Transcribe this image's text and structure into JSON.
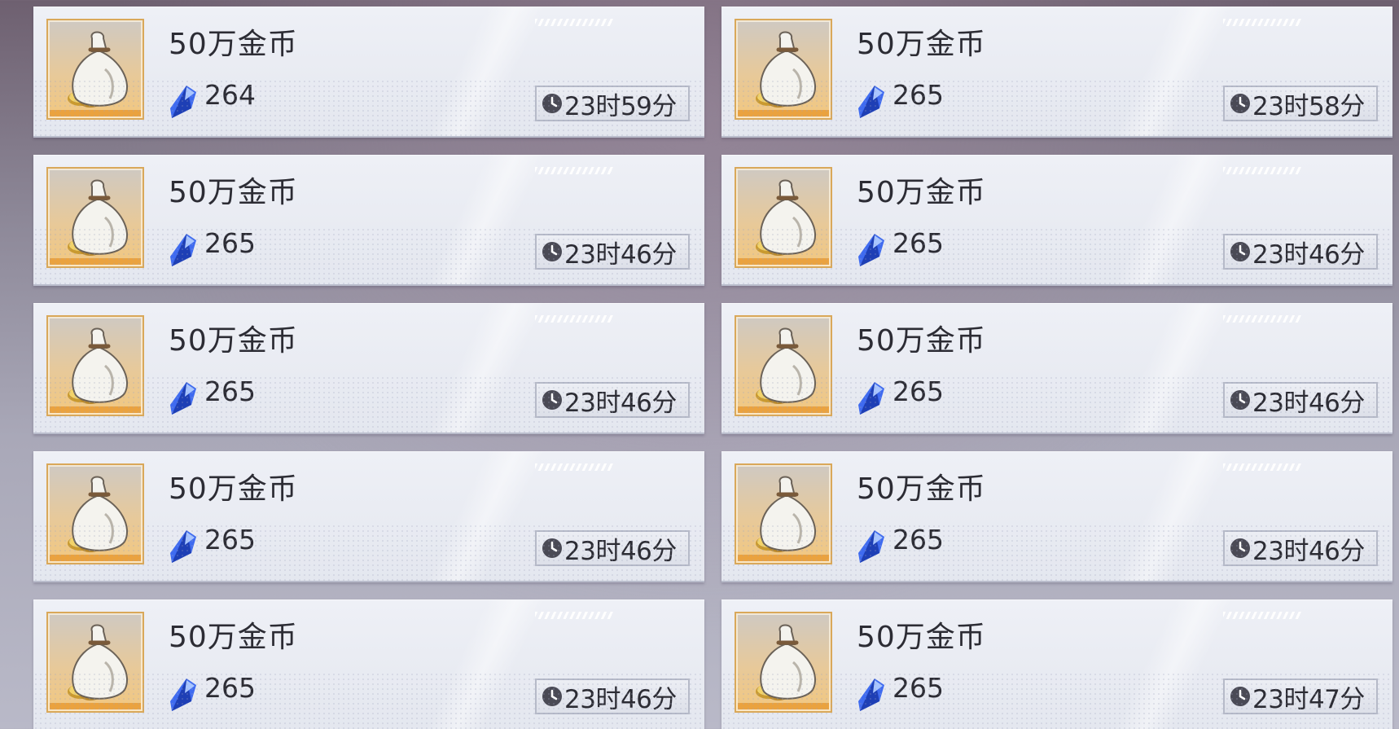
{
  "shop": {
    "items": [
      {
        "name": "50万金币",
        "price": "264",
        "timer": "23时59分",
        "item_icon": "coin-bag-icon",
        "currency_icon": "blue-crystal-icon",
        "timer_icon": "clock-icon"
      },
      {
        "name": "50万金币",
        "price": "265",
        "timer": "23时58分",
        "item_icon": "coin-bag-icon",
        "currency_icon": "blue-crystal-icon",
        "timer_icon": "clock-icon"
      },
      {
        "name": "50万金币",
        "price": "265",
        "timer": "23时46分",
        "item_icon": "coin-bag-icon",
        "currency_icon": "blue-crystal-icon",
        "timer_icon": "clock-icon"
      },
      {
        "name": "50万金币",
        "price": "265",
        "timer": "23时46分",
        "item_icon": "coin-bag-icon",
        "currency_icon": "blue-crystal-icon",
        "timer_icon": "clock-icon"
      },
      {
        "name": "50万金币",
        "price": "265",
        "timer": "23时46分",
        "item_icon": "coin-bag-icon",
        "currency_icon": "blue-crystal-icon",
        "timer_icon": "clock-icon"
      },
      {
        "name": "50万金币",
        "price": "265",
        "timer": "23时46分",
        "item_icon": "coin-bag-icon",
        "currency_icon": "blue-crystal-icon",
        "timer_icon": "clock-icon"
      },
      {
        "name": "50万金币",
        "price": "265",
        "timer": "23时46分",
        "item_icon": "coin-bag-icon",
        "currency_icon": "blue-crystal-icon",
        "timer_icon": "clock-icon"
      },
      {
        "name": "50万金币",
        "price": "265",
        "timer": "23时46分",
        "item_icon": "coin-bag-icon",
        "currency_icon": "blue-crystal-icon",
        "timer_icon": "clock-icon"
      },
      {
        "name": "50万金币",
        "price": "265",
        "timer": "23时46分",
        "item_icon": "coin-bag-icon",
        "currency_icon": "blue-crystal-icon",
        "timer_icon": "clock-icon"
      },
      {
        "name": "50万金币",
        "price": "265",
        "timer": "23时47分",
        "item_icon": "coin-bag-icon",
        "currency_icon": "blue-crystal-icon",
        "timer_icon": "clock-icon"
      }
    ]
  },
  "colors": {
    "card_bg": "#e8ebf2",
    "item_frame_border": "#d9a85a",
    "item_frame_bar": "#eaa23f",
    "crystal": "#2f55d6",
    "text": "#2c2c34"
  }
}
